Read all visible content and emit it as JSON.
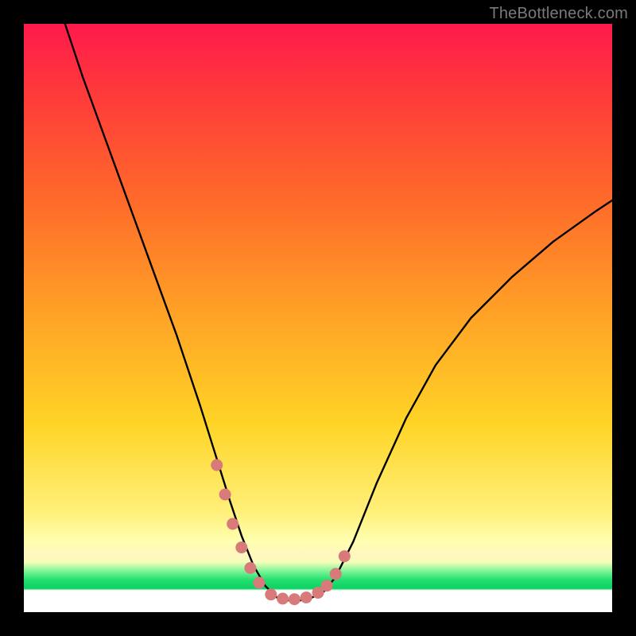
{
  "watermark": "TheBottleneck.com",
  "chart_data": {
    "type": "line",
    "title": "",
    "xlabel": "",
    "ylabel": "",
    "xlim": [
      0,
      100
    ],
    "ylim": [
      0,
      100
    ],
    "grid": false,
    "legend": false,
    "series": [
      {
        "name": "curve",
        "color": "#000000",
        "x": [
          7,
          10,
          14,
          18,
          22,
          26,
          30,
          32.5,
          35,
          37,
          39,
          41,
          43,
          45,
          47,
          49,
          51,
          53,
          56,
          60,
          65,
          70,
          76,
          83,
          90,
          97,
          100
        ],
        "y": [
          100,
          91,
          80,
          69,
          58,
          47,
          35,
          27,
          19,
          13,
          8,
          4.5,
          2.5,
          2,
          2,
          2.5,
          3.5,
          6,
          12,
          22,
          33,
          42,
          50,
          57,
          63,
          68,
          70
        ]
      },
      {
        "name": "highlight-dots",
        "color": "#d97a7a",
        "type": "scatter",
        "x": [
          32.8,
          34.2,
          35.5,
          37,
          38.5,
          40,
          42,
          44,
          46,
          48,
          50,
          51.5,
          53,
          54.5
        ],
        "y": [
          25,
          20,
          15,
          11,
          7.5,
          5,
          3,
          2.3,
          2.2,
          2.5,
          3.3,
          4.5,
          6.5,
          9.5
        ]
      }
    ],
    "annotations": []
  },
  "colors": {
    "background_top": "#ff1a4d",
    "background_mid": "#ffd426",
    "background_low": "#fff07a",
    "band_green": "#22e06e",
    "curve": "#000000",
    "dots": "#d97a7a",
    "frame": "#000000"
  }
}
